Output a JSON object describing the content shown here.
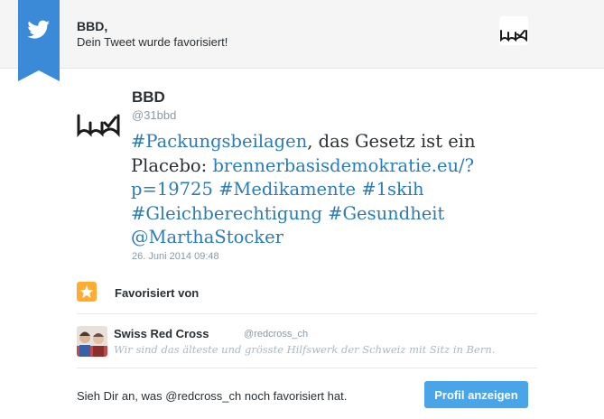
{
  "colors": {
    "brand_blue": "#2b7bb9",
    "ribbon_blue": "#3b8ad8",
    "star_orange": "#ffac33",
    "button_blue": "#4aa4e8"
  },
  "notification": {
    "title": "BBD,",
    "subtitle": "Dein Tweet wurde favorisiert!",
    "icon": "twitter-bird-icon"
  },
  "tweet": {
    "author_name": "BBD",
    "author_handle": "@31bbd",
    "segments": [
      {
        "text": "#Packungsbeilagen",
        "link": true
      },
      {
        "text": ", das Gesetz ist ein Placebo: ",
        "link": false
      },
      {
        "text": "brennerbasisdemokratie.eu/?p=19725",
        "link": true
      },
      {
        "text": " ",
        "link": false
      },
      {
        "text": "#Medikamente",
        "link": true
      },
      {
        "text": " ",
        "link": false
      },
      {
        "text": "#1skih",
        "link": true
      },
      {
        "text": " ",
        "link": false
      },
      {
        "text": "#Gleichberechtigung",
        "link": true
      },
      {
        "text": " ",
        "link": false
      },
      {
        "text": "#Gesundheit",
        "link": true
      },
      {
        "text": " ",
        "link": false
      },
      {
        "text": "@MarthaStocker",
        "link": true
      }
    ],
    "date": "26. Juni 2014 09:48"
  },
  "favorited_by": {
    "label": "Favorisiert von",
    "icon": "star-icon",
    "user": {
      "name": "Swiss Red Cross",
      "handle": "@redcross_ch",
      "bio": "Wir sind das älteste und grösste Hilfswerk der Schweiz mit Sitz in Bern."
    }
  },
  "footer": {
    "text": "Sieh Dir an, was @redcross_ch noch favorisiert hat.",
    "button_label": "Profil anzeigen"
  }
}
